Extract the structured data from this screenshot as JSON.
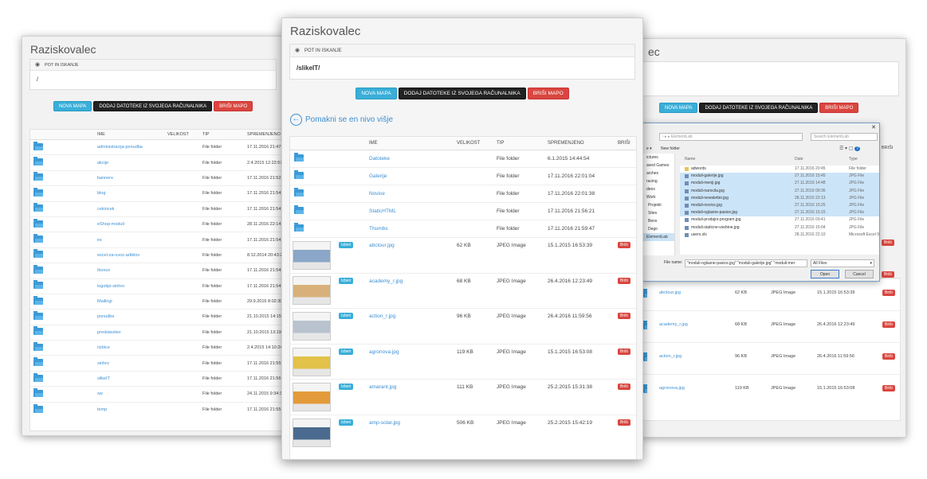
{
  "window_title": "Raziskovalec",
  "path_label": "POT IN ISKANJE",
  "left": {
    "path_value": "/",
    "buttons": {
      "new_folder": "NOVA MAPA",
      "upload": "DODAJ DATOTEKE IZ SVOJEGA RAČUNALNIKA",
      "delete_folder": "BRIŠI MAPO"
    },
    "columns": [
      "IME",
      "VELIKOST",
      "TIP",
      "SPREMENJENO"
    ],
    "rows": [
      {
        "name": "administracija-ponudba",
        "type": "File folder",
        "date": "17.11.2016 21:47:5"
      },
      {
        "name": "akcije",
        "type": "File folder",
        "date": "2.4.2015 12:22:57"
      },
      {
        "name": "banners",
        "type": "File folder",
        "date": "17.11.2016 21:52:5"
      },
      {
        "name": "blog",
        "type": "File folder",
        "date": "17.11.2016 21:54:"
      },
      {
        "name": "cekincek",
        "type": "File folder",
        "date": "17.11.2016 21:54:0"
      },
      {
        "name": "eShop-moduli",
        "type": "File folder",
        "date": "28.11.2016 22:14:"
      },
      {
        "name": "es",
        "type": "File folder",
        "date": "17.11.2016 21:54:"
      },
      {
        "name": "excel-za-uvoz-artiklov",
        "type": "File folder",
        "date": "8.12.2014 20:43:29"
      },
      {
        "name": "Ikonce",
        "type": "File folder",
        "date": "17.11.2016 21:54:"
      },
      {
        "name": "logotipi-sinhro",
        "type": "File folder",
        "date": "17.11.2016 21:54:5"
      },
      {
        "name": "Mailingi",
        "type": "File folder",
        "date": "29.9.2016 8:02:30"
      },
      {
        "name": "ponudbe",
        "type": "File folder",
        "date": "21.10.2015 14:15:"
      },
      {
        "name": "predstavitev",
        "type": "File folder",
        "date": "21.10.2015 13:19:"
      },
      {
        "name": "rizbice",
        "type": "File folder",
        "date": "2.4.2015 14:10:24"
      },
      {
        "name": "sinhro",
        "type": "File folder",
        "date": "17.11.2016 21:55:"
      },
      {
        "name": "slikeIT",
        "type": "File folder",
        "date": "17.11.2016 21:56:"
      },
      {
        "name": "sw",
        "type": "File folder",
        "date": "24.11.2015 9:34:32"
      },
      {
        "name": "temp",
        "type": "File folder",
        "date": "17.11.2016 21:55:"
      }
    ]
  },
  "center": {
    "path_value": "/slikeIT/",
    "buttons": {
      "new_folder": "NOVA MAPA",
      "upload": "DODAJ DATOTEKE IZ SVOJEGA RAČUNALNIKA",
      "delete_folder": "BRIŠI MAPO"
    },
    "up_level": "Pomakni se en nivo višje",
    "columns": [
      "IME",
      "VELIKOST",
      "TIP",
      "SPREMENJENO",
      "BRIŠI"
    ],
    "select_label": "Izberi",
    "delete_label": "Briši",
    "folders": [
      {
        "name": "Datoteke",
        "type": "File folder",
        "date": "6.1.2015 14:44:54"
      },
      {
        "name": "Galerije",
        "type": "File folder",
        "date": "17.11.2016 22:01:04"
      },
      {
        "name": "Novice",
        "type": "File folder",
        "date": "17.11.2016 22:01:38"
      },
      {
        "name": "StaticHTML",
        "type": "File folder",
        "date": "17.11.2016 21:56:21"
      },
      {
        "name": "Thumbs",
        "type": "File folder",
        "date": "17.11.2016 21:59:47"
      }
    ],
    "files": [
      {
        "name": "abctour.jpg",
        "size": "62 KB",
        "type": "JPEG Image",
        "date": "15.1.2015 16:53:39",
        "thumb": "#8aa6c8"
      },
      {
        "name": "academy_r.jpg",
        "size": "68 KB",
        "type": "JPEG Image",
        "date": "26.4.2016 12:23:49",
        "thumb": "#d8b07a"
      },
      {
        "name": "action_r.jpg",
        "size": "96 KB",
        "type": "JPEG Image",
        "date": "26.4.2016 11:59:56",
        "thumb": "#b9c3cf"
      },
      {
        "name": "agronova.jpg",
        "size": "119 KB",
        "type": "JPEG Image",
        "date": "15.1.2015 16:53:08",
        "thumb": "#e3c24a"
      },
      {
        "name": "amarant.jpg",
        "size": "111 KB",
        "type": "JPEG Image",
        "date": "25.2.2015 15:31:38",
        "thumb": "#e39a3a"
      },
      {
        "name": "amp-solar.jpg",
        "size": "506 KB",
        "type": "JPEG Image",
        "date": "25.2.2015 15:42:19",
        "thumb": "#4a6b8f"
      }
    ]
  },
  "right": {
    "buttons": {
      "new_folder": "NOVA MAPA",
      "upload": "DODAJ DATOTEKE IZ SVOJEGA RAČUNALNIKA",
      "delete_folder": "BRIŠI MAPO"
    },
    "col_brisi": "BRIŠI",
    "delete_label": "Briši",
    "files": [
      {
        "name": "abctour.jpg",
        "size": "62 KB",
        "type": "JPEG Image",
        "date": "15.1.2015 16:53:39"
      },
      {
        "name": "academy_r.jpg",
        "size": "68 KB",
        "type": "JPEG Image",
        "date": "26.4.2016 12:23:49"
      },
      {
        "name": "action_r.jpg",
        "size": "96 KB",
        "type": "JPEG Image",
        "date": "26.4.2016 11:59:56"
      },
      {
        "name": "agronova.jpg",
        "size": "119 KB",
        "type": "JPEG Image",
        "date": "15.1.2015 16:53:08"
      }
    ]
  },
  "dialog": {
    "search_placeholder": "Search ElementLab",
    "new_folder": "New folder",
    "col_name": "Name",
    "col_date": "Date",
    "col_type": "Type",
    "tree": [
      "ictures",
      "aved Games",
      "arches",
      "racing",
      "deos",
      "Work",
      "Projekti",
      "Sites",
      "Bens",
      "Dego",
      "ElementLab"
    ],
    "files": [
      {
        "name": "adwords",
        "date": "17.11.2016 20:45",
        "type": "File folder",
        "selected": false
      },
      {
        "name": "moduli-galerije.jpg",
        "date": "27.11.2016 15:45",
        "type": "JPG File",
        "selected": true
      },
      {
        "name": "moduli-menji.jpg",
        "date": "27.11.2016 14:48",
        "type": "JPG File",
        "selected": true
      },
      {
        "name": "moduli-narocila.jpg",
        "date": "27.11.2016 09:36",
        "type": "JPG File",
        "selected": true
      },
      {
        "name": "moduli-newsletter.jpg",
        "date": "28.11.2016 22:13",
        "type": "JPG File",
        "selected": true
      },
      {
        "name": "moduli-novice.jpg",
        "date": "27.11.2016 15:25",
        "type": "JPG File",
        "selected": true
      },
      {
        "name": "moduli-oglasne-pasice.jpg",
        "date": "27.11.2016 15:15",
        "type": "JPG File",
        "selected": true
      },
      {
        "name": "moduli-prodajni-program.jpg",
        "date": "27.11.2016 09:41",
        "type": "JPG File",
        "selected": false
      },
      {
        "name": "moduli-staticne-vsebine.jpg",
        "date": "27.11.2016 15:04",
        "type": "JPG File",
        "selected": false
      },
      {
        "name": "users.xls",
        "date": "28.11.2016 22:10",
        "type": "Microsoft Excel 9",
        "selected": false
      }
    ],
    "file_name_label": "File name:",
    "file_name_value": "\"moduli-oglasne-pasice.jpg\" \"moduli-galerije.jpg\" \"moduli-mer",
    "file_type": "All Files",
    "open": "Open",
    "cancel": "Cancel"
  }
}
